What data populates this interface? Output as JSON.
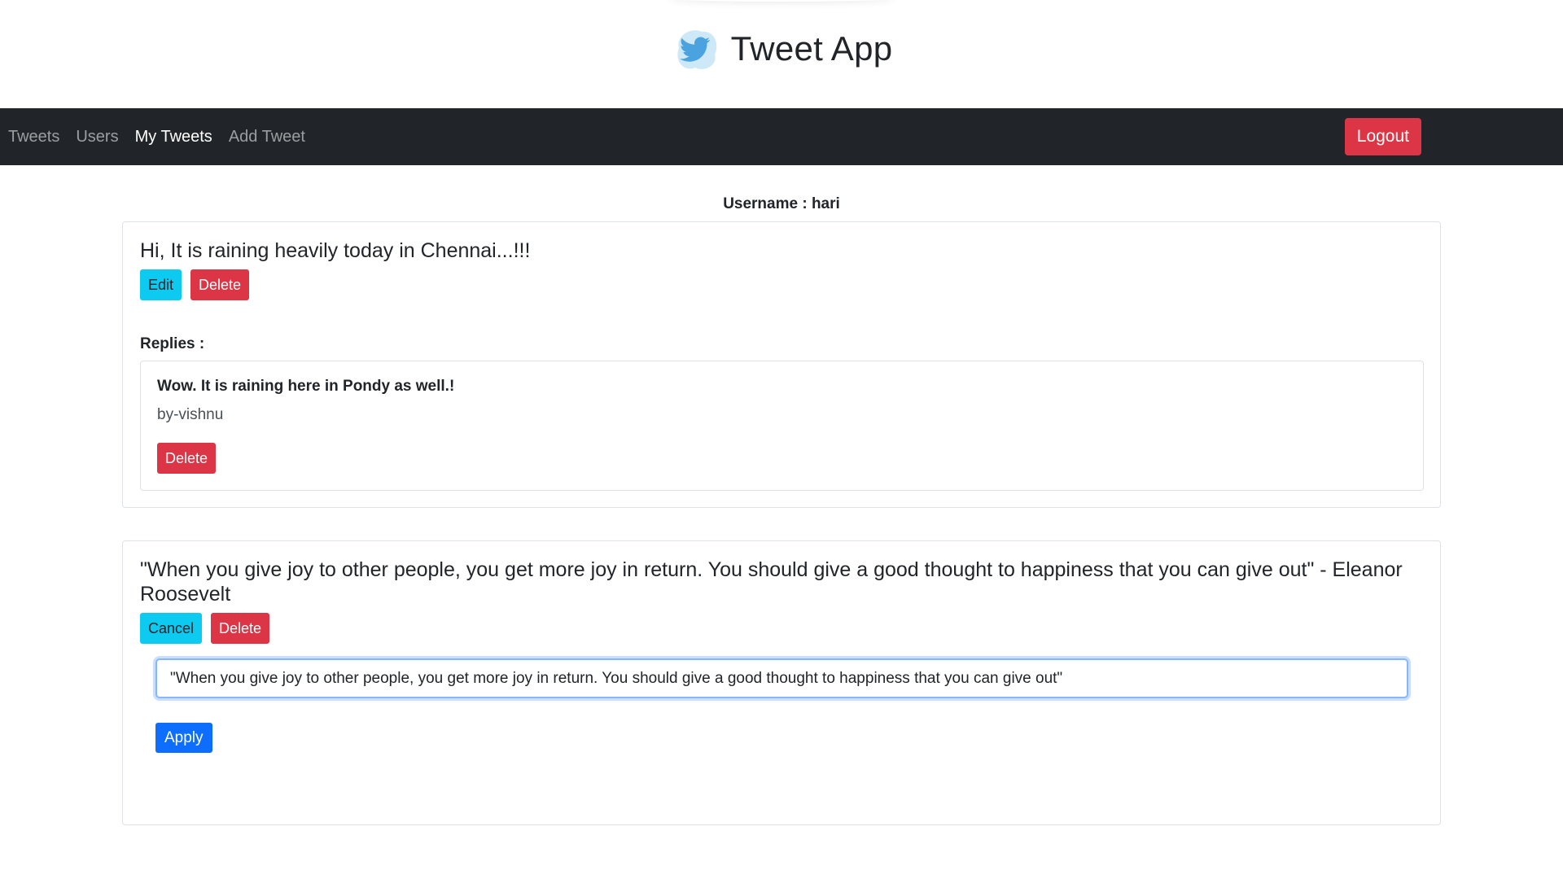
{
  "header": {
    "title": "Tweet App",
    "logo_icon": "twitter-bird-icon",
    "logo_colors": {
      "bird": "#4aa3df",
      "blob": "#cde8f7"
    }
  },
  "nav": {
    "items": [
      {
        "label": "Tweets",
        "active": false
      },
      {
        "label": "Users",
        "active": false
      },
      {
        "label": "My Tweets",
        "active": true
      },
      {
        "label": "Add Tweet",
        "active": false
      }
    ],
    "logout_label": "Logout",
    "bg_color": "#212529"
  },
  "user": {
    "username_text": "Username : hari"
  },
  "tweets": [
    {
      "text": "Hi, It is raining heavily today in Chennai...!!!",
      "edit_label": "Edit",
      "delete_label": "Delete",
      "replies_label": "Replies :",
      "replies": [
        {
          "text": "Wow. It is raining here in Pondy as well.!",
          "author": "by-vishnu",
          "delete_label": "Delete"
        }
      ]
    },
    {
      "text": "\"When you give joy to other people, you get more joy in return. You should give a good thought to happiness that you can give out\" - Eleanor Roosevelt",
      "cancel_label": "Cancel",
      "delete_label": "Delete",
      "edit_value": "\"When you give joy to other people, you get more joy in return. You should give a good thought to happiness that you can give out\"",
      "apply_label": "Apply"
    }
  ],
  "colors": {
    "danger": "#dc3545",
    "info": "#0dcaf0",
    "primary": "#0d6efd"
  }
}
